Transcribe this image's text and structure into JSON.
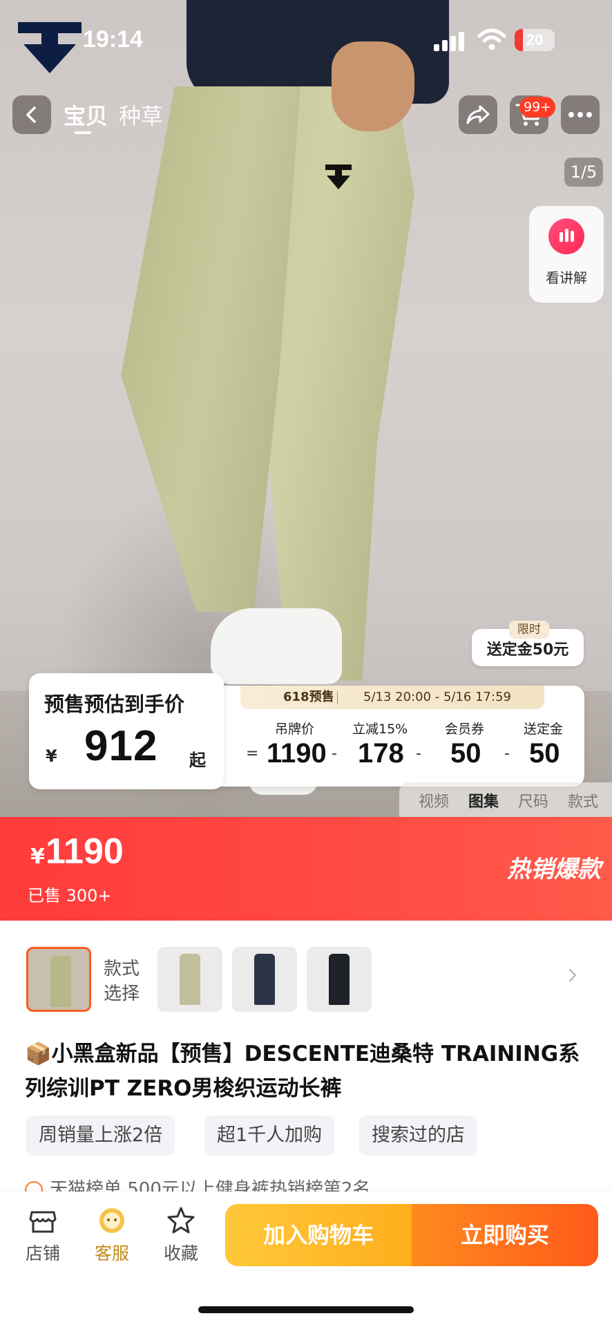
{
  "status_bar": {
    "time": "19:14",
    "battery": "20",
    "battery_level": 0.2
  },
  "nav": {
    "tabs": [
      "宝贝",
      "种草"
    ],
    "cart_badge": "99+",
    "icons": [
      "back-icon",
      "share-icon",
      "cart-icon",
      "more-icon"
    ]
  },
  "gallery": {
    "counter": "1/5",
    "explain_label": "看讲解",
    "deposit_badge": "限时",
    "deposit_text": "送定金50元",
    "media_tabs": [
      "视频",
      "图集",
      "尺码",
      "款式"
    ],
    "active_media_tab": "图集"
  },
  "presale": {
    "title": "预售预估到手价",
    "currency": "¥",
    "price": "912",
    "suffix": "起",
    "event": "618预售",
    "range": "5/13 20:00 - 5/16 17:59",
    "equals": "=",
    "columns": [
      {
        "label": "吊牌价",
        "value": "1190",
        "op": "-"
      },
      {
        "label": "立减15%",
        "value": "178",
        "op": "-"
      },
      {
        "label": "会员券",
        "value": "50",
        "op": "-"
      },
      {
        "label": "送定金",
        "value": "50",
        "op": ""
      }
    ]
  },
  "price": {
    "currency": "¥",
    "value": "1190",
    "sold": "已售 300+",
    "hot_label": "热销爆款",
    "accent": "#ff3b3b"
  },
  "style": {
    "label_line1": "款式",
    "label_line2": "选择",
    "thumb_colors": [
      "#b7b88a",
      "#c1bf9c",
      "#2b3346",
      "#1f2228"
    ]
  },
  "product": {
    "title": "📦小黑盒新品【预售】DESCENTE迪桑特 TRAINING系列综训PT ZERO男梭织运动长裤",
    "tags": [
      "周销量上涨2倍",
      "超1千人加购",
      "搜索过的店"
    ],
    "rank_text": "天猫榜单 500元以上健身裤热销榜第2名"
  },
  "bottom_bar": {
    "shop": "店铺",
    "service": "客服",
    "favorite": "收藏",
    "add_to_cart": "加入购物车",
    "buy_now": "立即购买"
  }
}
